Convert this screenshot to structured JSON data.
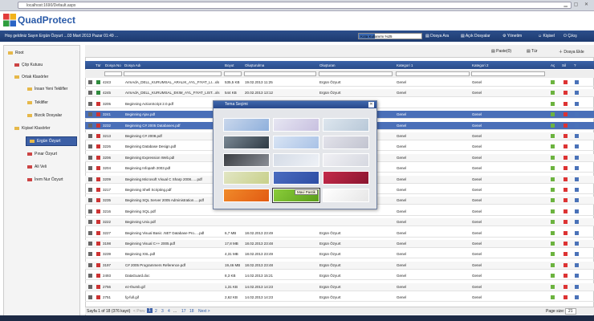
{
  "browser": {
    "url": "localhost:1690/Default.aspx"
  },
  "app": {
    "title": "QuadProtect"
  },
  "navbar": {
    "welcome": "Hoş geldiniz Sayın Ergün Özyurt ...03 Mart 2013 Pazar 01:49 ...",
    "quota": "Kota Kullanımı %25",
    "quota_pct": 25,
    "file_add": "Dosya Ara",
    "public_files": "Açık Dosyalar",
    "admin": "Yönetim",
    "profile": "Kişisel",
    "logout": "Çıkış"
  },
  "tree": [
    {
      "label": "Root"
    },
    {
      "label": "Çöp Kutusu"
    },
    {
      "label": "Ortak Klasörler"
    },
    {
      "label": "İnsan Yeni Teklifler"
    },
    {
      "label": "Teklifler"
    },
    {
      "label": "Bizcik Dosyalar"
    },
    {
      "label": "Kişisel Klasörler"
    },
    {
      "label": "Ergün Özyurt"
    },
    {
      "label": "Pınar Özyurt"
    },
    {
      "label": "Ali Veli"
    },
    {
      "label": "İrem Nur Özyurt"
    }
  ],
  "toolbar": {
    "paste": "Paste(0)",
    "type": "Tür",
    "add_file": "Dosya Ekle"
  },
  "columns": {
    "type": "Tür",
    "file_no": "Dosya No",
    "file_name": "Dosya Adı",
    "size": "Boyut",
    "created": "Oluşturulma",
    "creator": "Oluşturan",
    "cat1": "Kategori 1",
    "cat2": "Kategori 2",
    "open": "Aç",
    "del": "Sil",
    "info": "?"
  },
  "rows": [
    {
      "no": "4243",
      "name": "ArmAdA_DELL_KURUMSAL_ARALIK_AYL_FIYAT_LI...xls",
      "size": "535,5 KB",
      "date": "19.02.2013 11:25",
      "owner": "Ergün Özyurt",
      "c1": "Genel",
      "c2": "Genel"
    },
    {
      "no": "4245",
      "name": "ArmAdA_DELL_KURUMSAL_EKIM_AYL_FIYAT_LIST...xls",
      "size": "544 KB",
      "date": "20.02.2013 13:12",
      "owner": "Ergün Özyurt",
      "c1": "Genel",
      "c2": "Genel"
    },
    {
      "no": "3205",
      "name": "Beginning ActionScript 2.0.pdf",
      "size": "",
      "date": "",
      "owner": "",
      "c1": "",
      "c2": ""
    },
    {
      "no": "3241",
      "name": "Beginning Ajax.pdf",
      "size": "",
      "date": "",
      "owner": "",
      "c1": "Genel",
      "c2": "Genel"
    },
    {
      "no": "3232",
      "name": "Beginning C# 2005 Databases.pdf",
      "size": "",
      "date": "",
      "owner": "",
      "c1": "Genel",
      "c2": "Genel"
    },
    {
      "no": "3213",
      "name": "Beginning C# 2008.pdf",
      "size": "",
      "date": "",
      "owner": "",
      "c1": "Genel",
      "c2": "Genel"
    },
    {
      "no": "3226",
      "name": "Beginning Database Design.pdf",
      "size": "",
      "date": "",
      "owner": "",
      "c1": "Genel",
      "c2": "Genel"
    },
    {
      "no": "3206",
      "name": "Beginning Expression Web.pdf",
      "size": "",
      "date": "",
      "owner": "",
      "c1": "Genel",
      "c2": "Genel"
    },
    {
      "no": "3204",
      "name": "Beginning Infopath 2003.pdf",
      "size": "",
      "date": "",
      "owner": "",
      "c1": "Genel",
      "c2": "Genel"
    },
    {
      "no": "3209",
      "name": "Beginning Microsoft Visual C Sharp 2008......pdf",
      "size": "",
      "date": "",
      "owner": "",
      "c1": "Genel",
      "c2": "Genel"
    },
    {
      "no": "3217",
      "name": "Beginning Shell Scripting.pdf",
      "size": "",
      "date": "",
      "owner": "",
      "c1": "Genel",
      "c2": "Genel"
    },
    {
      "no": "3235",
      "name": "Beginning SQL Server 2005 Administration.....pdf",
      "size": "",
      "date": "",
      "owner": "",
      "c1": "Genel",
      "c2": "Genel"
    },
    {
      "no": "3216",
      "name": "Beginning SQL.pdf",
      "size": "",
      "date": "",
      "owner": "",
      "c1": "Genel",
      "c2": "Genel"
    },
    {
      "no": "3222",
      "name": "Beginning Unix.pdf",
      "size": "",
      "date": "",
      "owner": "",
      "c1": "Genel",
      "c2": "Genel"
    },
    {
      "no": "3227",
      "name": "Beginning Visual Basic .NET Database Pro.....pdf",
      "size": "6,7 MB",
      "date": "18.02.2013 23:49",
      "owner": "Ergün Özyurt",
      "c1": "Genel",
      "c2": "Genel"
    },
    {
      "no": "3198",
      "name": "Beginning Visual C++ 2005.pdf",
      "size": "17,8 MB",
      "date": "18.02.2013 23:48",
      "owner": "Ergün Özyurt",
      "c1": "Genel",
      "c2": "Genel"
    },
    {
      "no": "3239",
      "name": "Beginning XSL.pdf",
      "size": "4,31 MB",
      "date": "18.02.2013 23:49",
      "owner": "Ergün Özyurt",
      "c1": "Genel",
      "c2": "Genel"
    },
    {
      "no": "3197",
      "name": "C# 2005 Programmers Reference.pdf",
      "size": "19,46 MB",
      "date": "18.02.2013 23:48",
      "owner": "Ergün Özyurt",
      "c1": "Genel",
      "c2": "Genel"
    },
    {
      "no": "2493",
      "name": "DataGuard.doc",
      "size": "8,3 KB",
      "date": "14.02.2013 15:21",
      "owner": "Ergün Özyurt",
      "c1": "Genel",
      "c2": "Genel"
    },
    {
      "no": "2756",
      "name": "ez-thumb.gif",
      "size": "1,31 KB",
      "date": "14.02.2013 14:23",
      "owner": "Ergün Özyurt",
      "c1": "Genel",
      "c2": "Genel"
    },
    {
      "no": "2751",
      "name": "fg-full.gif",
      "size": "2,62 KB",
      "date": "14.02.2013 14:23",
      "owner": "Ergün Özyurt",
      "c1": "Genel",
      "c2": "Genel"
    }
  ],
  "pager": {
    "info": "Sayfa 1 of 18 (376 kayıt)",
    "prev": "< Prev",
    "pages": [
      "1",
      "2",
      "3",
      "4",
      "...",
      "17",
      "18"
    ],
    "next": "Next >",
    "page_size_label": "Page size:",
    "page_size": "21"
  },
  "dialog": {
    "title": "Tema Seçimi",
    "tooltip": "Mavi Pastik"
  }
}
